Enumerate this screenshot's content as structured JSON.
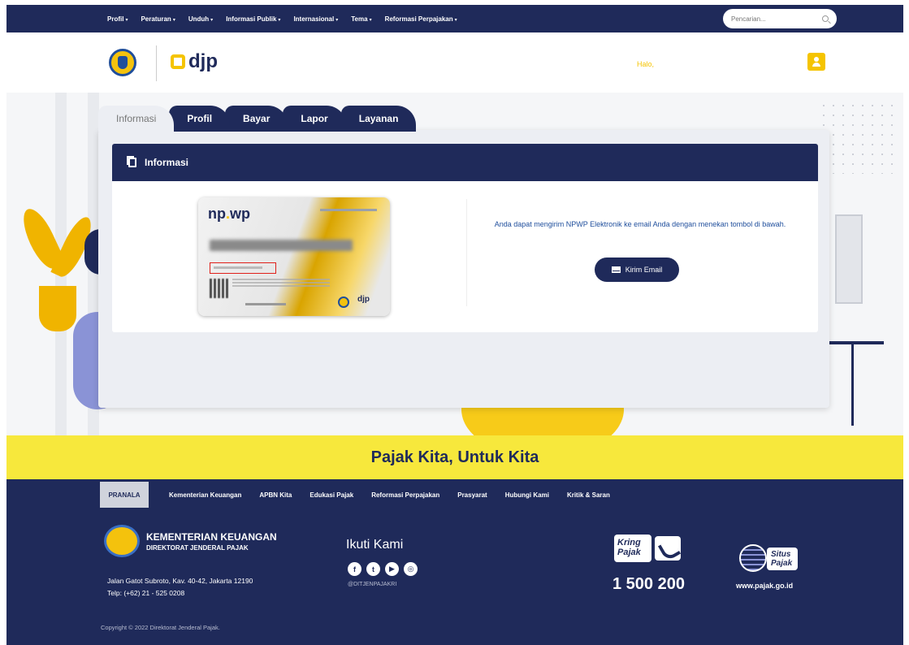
{
  "topnav": {
    "menu": [
      "Profil",
      "Peraturan",
      "Unduh",
      "Informasi Publik",
      "Internasional",
      "Tema",
      "Reformasi Perpajakan"
    ],
    "search_placeholder": "Pencarian..."
  },
  "header": {
    "brand": "djp",
    "greeting": "Halo,"
  },
  "tabs": [
    "Informasi",
    "Profil",
    "Bayar",
    "Lapor",
    "Layanan"
  ],
  "info": {
    "title": "Informasi",
    "card_logo_a": "np",
    "card_logo_b": "wp",
    "card_brand": "djp",
    "message": "Anda dapat mengirim NPWP Elektronik ke email Anda dengan menekan tombol di bawah.",
    "send_button": "Kirim Email"
  },
  "slogan": "Pajak Kita, Untuk Kita",
  "footer": {
    "pranala": "PRANALA",
    "links": [
      "Kementerian Keuangan",
      "APBN Kita",
      "Edukasi Pajak",
      "Reformasi Perpajakan",
      "Prasyarat",
      "Hubungi Kami",
      "Kritik & Saran"
    ],
    "org_name": "KEMENTERIAN KEUANGAN",
    "org_sub": "DIREKTORAT JENDERAL PAJAK",
    "address": "Jalan Gatot Subroto, Kav. 40-42, Jakarta 12190",
    "phone": "Telp: (+62) 21 - 525 0208",
    "copyright": "Copyright © 2022 Direktorat Jenderal Pajak.",
    "follow_title": "Ikuti Kami",
    "social": [
      "f",
      "t",
      "▶",
      "◎"
    ],
    "handle": "@DITJENPAJAKRI",
    "kring_line1": "Kring",
    "kring_line2": "Pajak",
    "kring_number": "1 500 200",
    "situs_line1": "Situs",
    "situs_line2": "Pajak",
    "situs_url": "www.pajak.go.id"
  },
  "colors": {
    "navy": "#1f2a5a",
    "yellow": "#f5c400",
    "slogan_bg": "#f7e83c"
  }
}
